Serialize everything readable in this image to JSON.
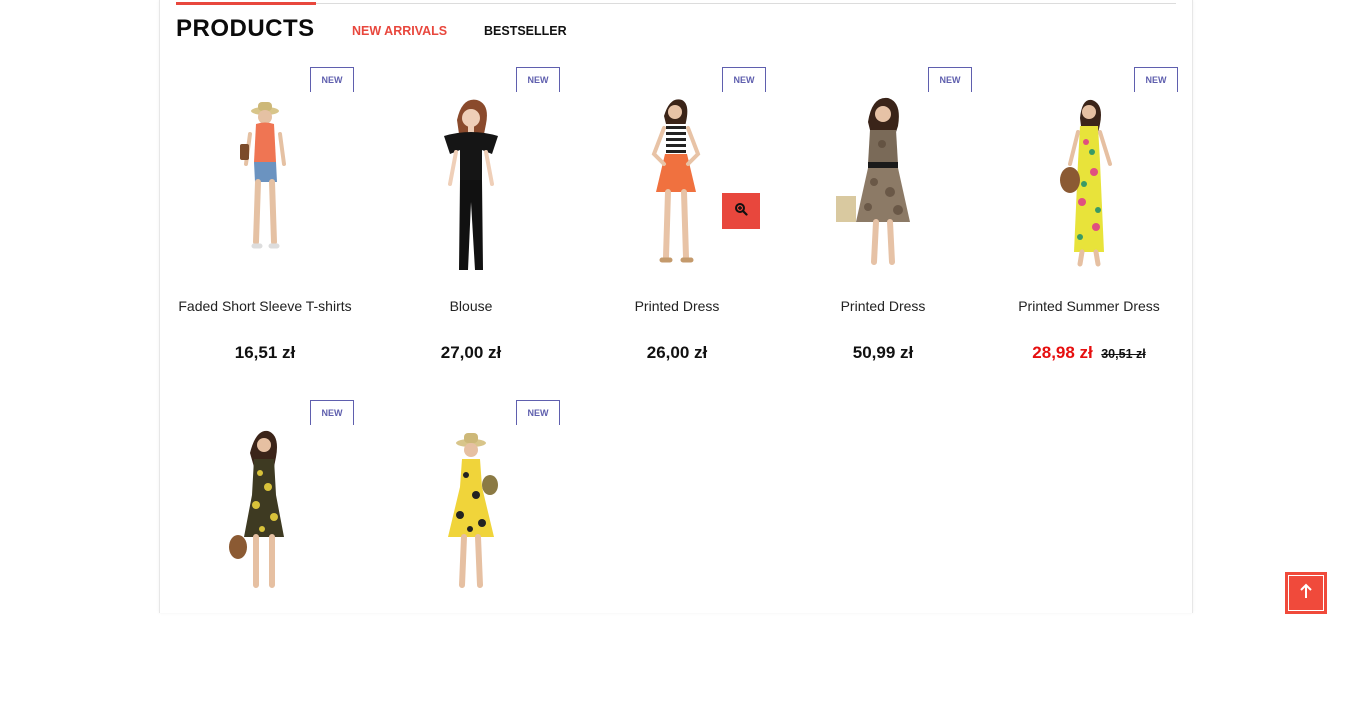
{
  "section": {
    "title": "PRODUCTS",
    "tabs": [
      {
        "label": "NEW ARRIVALS",
        "active": true
      },
      {
        "label": "BESTSELLER",
        "active": false
      }
    ]
  },
  "badge_label": "NEW",
  "products": [
    {
      "name": "Faded Short Sleeve T-shirts",
      "price": "16,51 zł",
      "old_price": "",
      "badge": "NEW"
    },
    {
      "name": "Blouse",
      "price": "27,00 zł",
      "old_price": "",
      "badge": "NEW"
    },
    {
      "name": "Printed Dress",
      "price": "26,00 zł",
      "old_price": "",
      "badge": "NEW"
    },
    {
      "name": "Printed Dress",
      "price": "50,99 zł",
      "old_price": "",
      "badge": "NEW"
    },
    {
      "name": "Printed Summer Dress",
      "price": "28,98 zł",
      "old_price": "30,51 zł",
      "badge": "NEW"
    },
    {
      "name": "",
      "price": "",
      "old_price": "",
      "badge": "NEW"
    },
    {
      "name": "",
      "price": "",
      "old_price": "",
      "badge": "NEW"
    }
  ],
  "colors": {
    "accent": "#e8473d",
    "sale": "#e60f0f",
    "badge": "#5f5fae"
  },
  "icons": {
    "quick_view": "zoom-in-icon",
    "back_to_top": "arrow-up-icon"
  }
}
